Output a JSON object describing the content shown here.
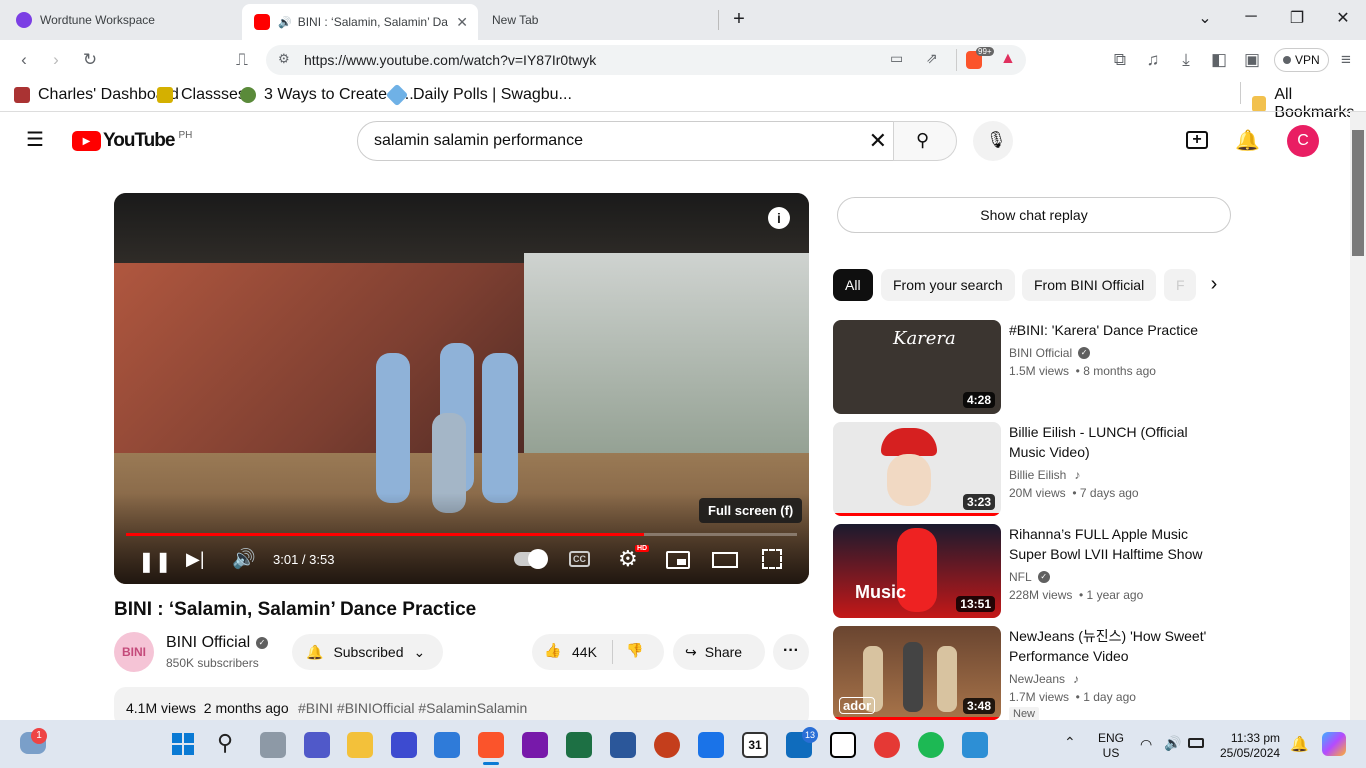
{
  "tabs": [
    {
      "title": "Wordtune Workspace"
    },
    {
      "title": "BINI : ‘Salamin, Salamin’ Dance Practice"
    },
    {
      "title": "New Tab"
    }
  ],
  "address": {
    "url": "https://www.youtube.com/watch?v=IY87Ir0twyk",
    "brave_badge": "99+",
    "vpn": "VPN"
  },
  "bookmarks": [
    "Charles' Dashboard",
    "Classses",
    "3 Ways to Create a...",
    "Daily Polls | Swagbu..."
  ],
  "all_bookmarks": "All Bookmarks",
  "yt": {
    "logo": "YouTube",
    "region": "PH",
    "search_value": "salamin salamin performance",
    "avatar_letter": "C"
  },
  "player": {
    "tooltip": "Full screen (f)",
    "time": "3:01 / 3:53",
    "progress": 0.772,
    "hd": "HD"
  },
  "video": {
    "title": "BINI : ‘Salamin, Salamin’ Dance Practice",
    "channel": "BINI Official",
    "subs": "850K subscribers",
    "subscribed": "Subscribed",
    "likes": "44K",
    "share": "Share",
    "desc_stats": "4.1M views  2 months ago",
    "hashtags": "#BINI #BINIOfficial #SalaminSalamin",
    "avatar_text": "BINI"
  },
  "chat_replay": "Show chat replay",
  "chips": [
    "All",
    "From your search",
    "From BINI Official",
    "F"
  ],
  "related": [
    {
      "title": "#BINI: 'Karera' Dance Practice",
      "channel": "BINI Official",
      "meta": "1.5M views  • 8 months ago",
      "dur": "4:28",
      "thumb_text": "Karera",
      "color": "#3b3530"
    },
    {
      "title": "Billie Eilish - LUNCH (Official Music Video)",
      "channel": "Billie Eilish",
      "meta": "20M views  • 7 days ago",
      "dur": "3:23",
      "color": "#e9e9e9"
    },
    {
      "title": "Rihanna’s FULL Apple Music Super Bowl LVII Halftime Show",
      "channel": "NFL",
      "meta": "228M views  • 1 year ago",
      "dur": "13:51",
      "thumb_text": "Music",
      "color": "#c41818"
    },
    {
      "title": "NewJeans (뉴진스) 'How Sweet' Performance Video",
      "channel": "NewJeans",
      "meta": "1.7M views  • 1 day ago",
      "dur": "3:48",
      "badge": "New",
      "thumb_text": "ador",
      "color": "#8a5c3a"
    }
  ],
  "taskbar": {
    "lang": "ENG",
    "region": "US",
    "time": "11:33 pm",
    "date": "25/05/2024",
    "weather_badge": "1",
    "outlook_badge": "13",
    "calendar_day": "31"
  }
}
